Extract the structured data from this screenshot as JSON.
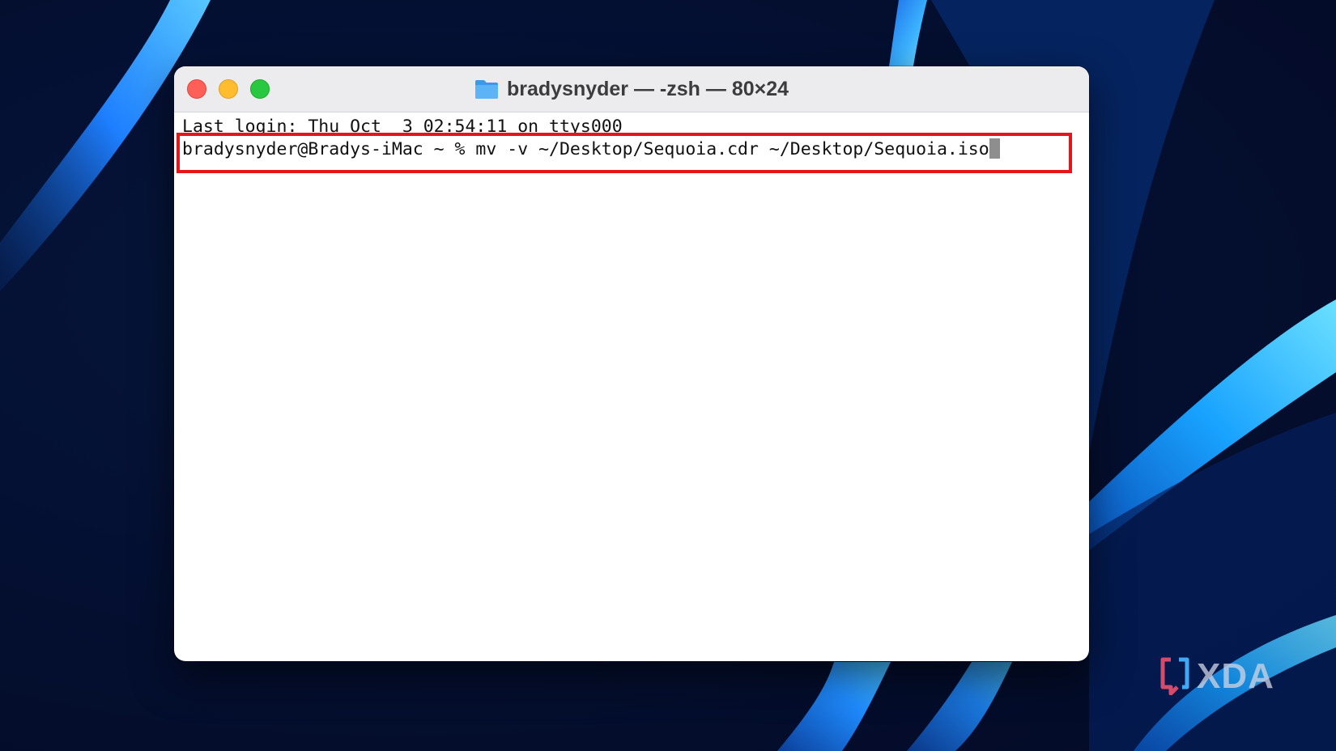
{
  "window": {
    "title": "bradysnyder — -zsh — 80×24"
  },
  "terminal": {
    "lines": [
      "Last login: Thu Oct  3 02:54:11 on ttys000",
      "bradysnyder@Bradys-iMac ~ % mv -v ~/Desktop/Sequoia.cdr ~/Desktop/Sequoia.iso"
    ]
  },
  "watermark": {
    "text": "XDA"
  },
  "colors": {
    "highlight": "#e5151b",
    "close": "#fe5f57",
    "minimize": "#febc2e",
    "zoom": "#28c840"
  },
  "icons": {
    "title": "folder-icon",
    "logo": "xda-logo-icon"
  }
}
